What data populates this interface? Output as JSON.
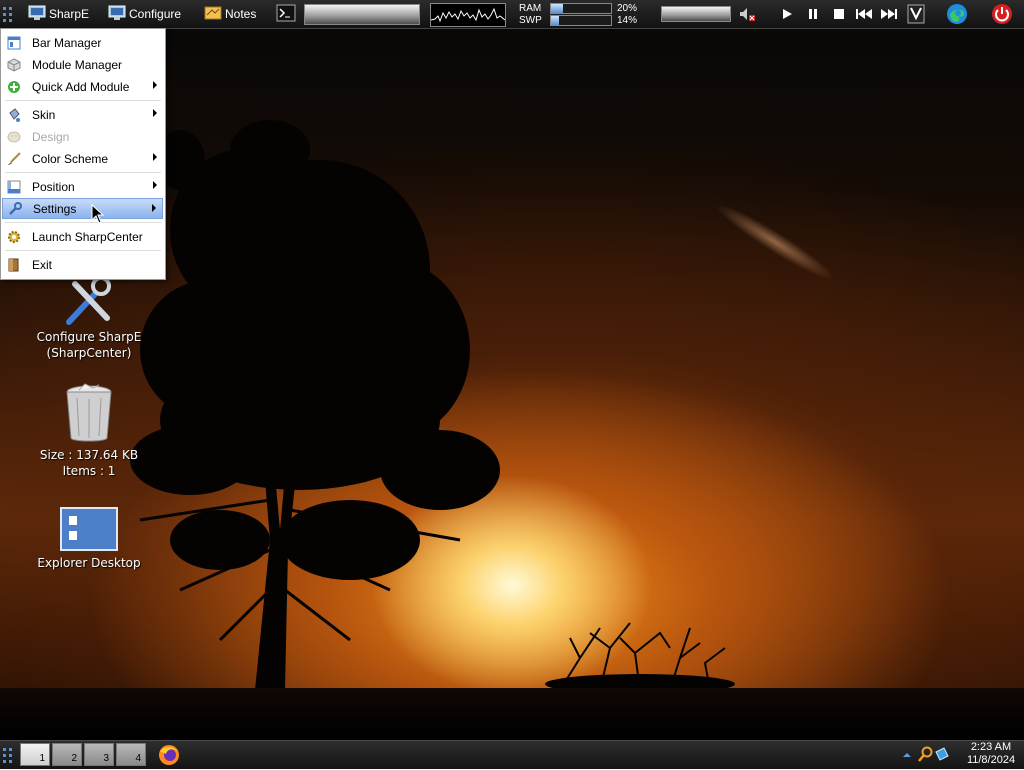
{
  "topbar": {
    "sharpe_label": "SharpE",
    "configure_label": "Configure",
    "notes_label": "Notes",
    "cmd_icon": "terminal-icon",
    "ram_label": "RAM",
    "swp_label": "SWP",
    "ram_percent": "20%",
    "swp_percent": "14%",
    "ram_fraction": 0.2,
    "swp_fraction": 0.14,
    "volume_icon": "speaker-muted-icon",
    "media_icons": [
      "play-icon",
      "pause-icon",
      "stop-icon",
      "previous-icon",
      "next-icon"
    ],
    "winamp_icon": "winamp-icon",
    "edge_icon": "edge-browser-icon",
    "power_icon": "power-icon"
  },
  "menu": {
    "items": [
      {
        "label": "Bar Manager",
        "icon": "bar-manager-icon"
      },
      {
        "label": "Module Manager",
        "icon": "module-cube-icon"
      },
      {
        "label": "Quick Add Module",
        "icon": "add-green-icon",
        "submenu": true
      },
      {
        "label": "Skin",
        "icon": "paint-bucket-icon",
        "submenu": true
      },
      {
        "label": "Design",
        "icon": "design-icon",
        "disabled": true
      },
      {
        "label": "Color Scheme",
        "icon": "brush-icon",
        "submenu": true
      },
      {
        "label": "Position",
        "icon": "position-icon",
        "submenu": true
      },
      {
        "label": "Settings",
        "icon": "wrench-icon",
        "submenu": true,
        "highlighted": true
      },
      {
        "label": "Launch SharpCenter",
        "icon": "gear-icon"
      },
      {
        "label": "Exit",
        "icon": "exit-door-icon"
      }
    ]
  },
  "desktop_icons": [
    {
      "line1": "Configure SharpE",
      "line2": "(SharpCenter)",
      "icon": "configure-tools-icon"
    },
    {
      "line1": "Size : 137.64 KB",
      "line2": "Items : 1",
      "icon": "recycle-bin-icon"
    },
    {
      "line1": "Explorer Desktop",
      "icon": "explorer-desktop-icon"
    }
  ],
  "bottombar": {
    "workspaces": [
      "1",
      "2",
      "3",
      "4"
    ],
    "active_workspace": "1",
    "firefox_icon": "firefox-icon",
    "tray_icons": [
      "tray-arrow-icon",
      "search-icon",
      "network-icon"
    ],
    "clock_time": "2:23 AM",
    "clock_date": "11/8/2024"
  },
  "colors": {
    "menu_highlight": "#8ab3ee",
    "bar_dark": "#141414",
    "power_red": "#d42020",
    "sun_orange": "#f6941c"
  }
}
